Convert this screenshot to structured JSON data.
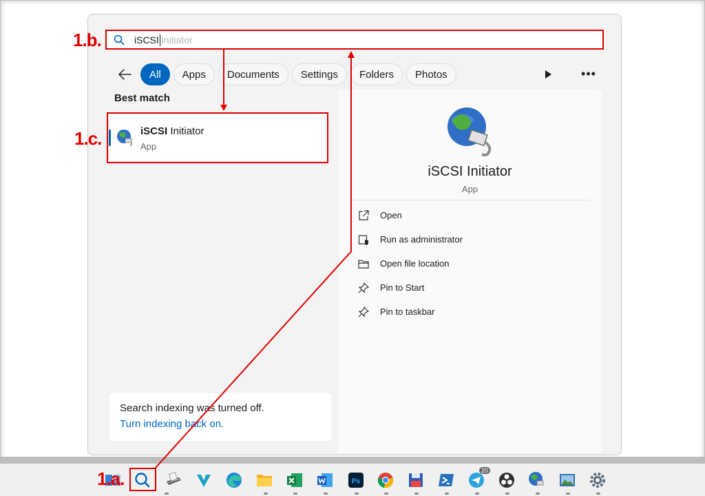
{
  "search": {
    "typed": "iSCSI",
    "suggestion": "Initiator"
  },
  "filters": [
    "All",
    "Apps",
    "Documents",
    "Settings",
    "Folders",
    "Photos"
  ],
  "results": {
    "section_label": "Best match",
    "item": {
      "title_bold": "iSCSI",
      "title_rest": " Initiator",
      "subtitle": "App"
    }
  },
  "details": {
    "title": "iSCSI Initiator",
    "subtitle": "App",
    "actions": [
      "Open",
      "Run as administrator",
      "Open file location",
      "Pin to Start",
      "Pin to taskbar"
    ]
  },
  "indexing": {
    "message": "Search indexing was turned off.",
    "link": "Turn indexing back on."
  },
  "annotations": {
    "a": "1.a.",
    "b": "1.b.",
    "c": "1.c.",
    "color": "#e00000"
  },
  "taskbar": {
    "icons": [
      "widgets-icon",
      "search-icon",
      "scanner-icon",
      "vivaldi-icon",
      "edge-icon",
      "file-explorer-icon",
      "excel-icon",
      "word-icon",
      "photoshop-icon",
      "chrome-icon",
      "floppy-save-icon",
      "powershell-icon",
      "telegram-icon",
      "obs-icon",
      "iscsi-globe-icon",
      "photo-viewer-icon",
      "settings-gear-icon"
    ],
    "telegram_badge": "20"
  },
  "colors": {
    "accent": "#0067c0"
  }
}
